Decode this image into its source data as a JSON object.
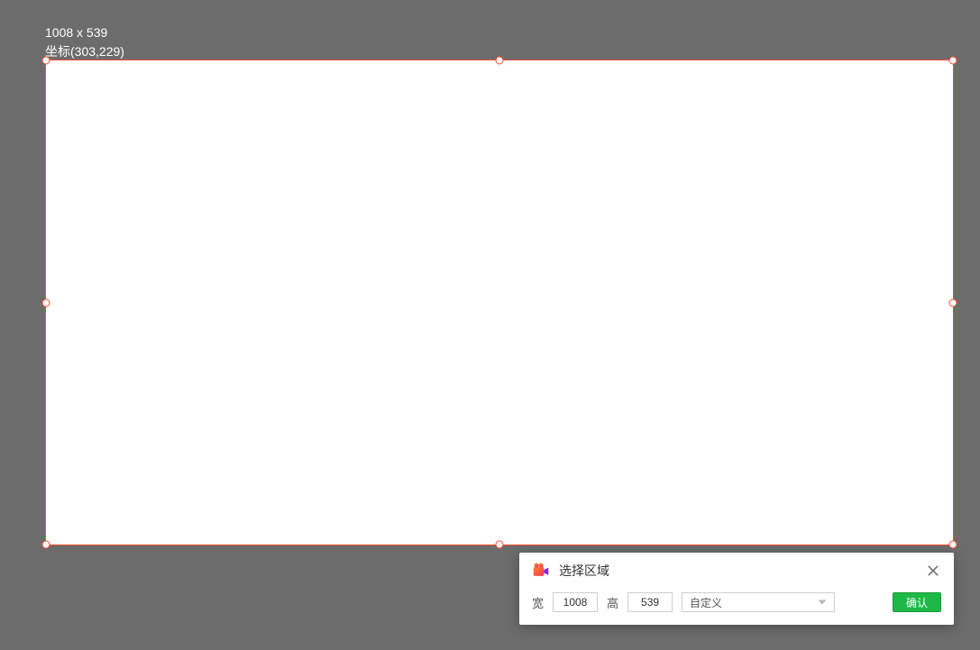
{
  "info": {
    "dimensions": "1008 x 539",
    "coordinates": "坐标(303,229)"
  },
  "panel": {
    "title": "选择区域",
    "width_label": "宽",
    "width_value": "1008",
    "height_label": "高",
    "height_value": "539",
    "preset_selected": "自定义",
    "confirm_label": "确认"
  }
}
